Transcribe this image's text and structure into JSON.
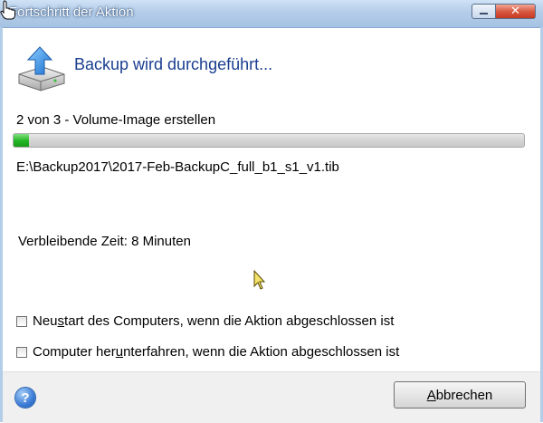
{
  "window": {
    "title": "Fortschritt der Aktion",
    "close_glyph": "✕"
  },
  "header": {
    "icon": "backup-disk-upload-icon",
    "status": "Backup wird durchgeführt..."
  },
  "operation": {
    "step": "2 von 3 - Volume-Image erstellen",
    "progress_fraction": 0.03,
    "file_path": "E:\\Backup2017\\2017-Feb-BackupC_full_b1_s1_v1.tib",
    "remaining_time": "Verbleibende Zeit: 8 Minuten"
  },
  "options": {
    "restart": {
      "pre": "Neu",
      "key": "s",
      "post": "tart des Computers, wenn die Aktion abgeschlossen ist",
      "checked": false
    },
    "shutdown": {
      "pre": "Computer her",
      "key": "u",
      "post": "nterfahren, wenn die Aktion abgeschlossen ist",
      "checked": false
    }
  },
  "footer": {
    "help_glyph": "?",
    "cancel": {
      "key": "A",
      "rest": "bbrechen"
    }
  },
  "colors": {
    "accent_text": "#1a3e8f",
    "progress_green": "#22b522",
    "titlebar": "#b4cde9"
  }
}
